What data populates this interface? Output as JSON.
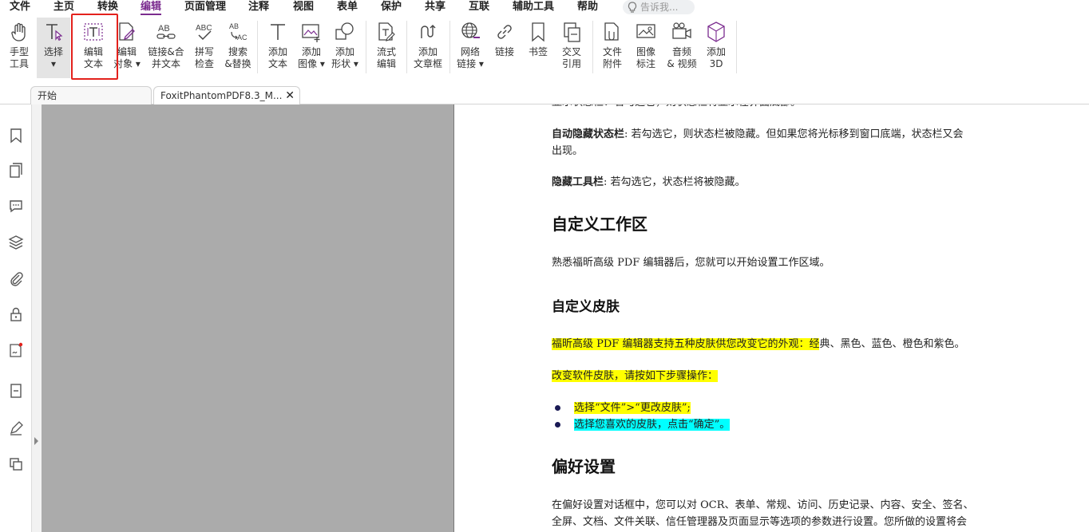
{
  "menu": {
    "items": [
      "文件",
      "主页",
      "转换",
      "编辑",
      "页面管理",
      "注释",
      "视图",
      "表单",
      "保护",
      "共享",
      "互联",
      "辅助工具",
      "帮助"
    ],
    "active": "编辑",
    "tellme_placeholder": "告诉我..."
  },
  "ribbon": {
    "hand": [
      "手型",
      "工具"
    ],
    "select": [
      "选择",
      "▾"
    ],
    "edit_text": [
      "编辑",
      "文本"
    ],
    "edit_object": [
      "编辑",
      "对象 ▾"
    ],
    "link_merge": [
      "链接&合",
      "并文本"
    ],
    "spell": [
      "拼写",
      "检查"
    ],
    "search_replace": [
      "搜索",
      "&替换"
    ],
    "add_text": [
      "添加",
      "文本"
    ],
    "add_image": [
      "添加",
      "图像 ▾"
    ],
    "add_shape": [
      "添加",
      "形状 ▾"
    ],
    "flow_edit": [
      "流式",
      "编辑"
    ],
    "add_textbox": [
      "添加",
      "文章框"
    ],
    "web_link": [
      "网络",
      "链接 ▾"
    ],
    "link": [
      "链接"
    ],
    "bookmark": [
      "书签"
    ],
    "cross_ref": [
      "交叉",
      "引用"
    ],
    "file_attach": [
      "文件",
      "附件"
    ],
    "image_mark": [
      "图像",
      "标注"
    ],
    "audio_video": [
      "音频",
      "& 视频"
    ],
    "add_3d": [
      "添加",
      "3D"
    ]
  },
  "tabs": {
    "start": "开始",
    "doc": "FoxitPhantomPDF8.3_M...",
    "close": "✕"
  },
  "doc": {
    "top_partial": "显示状态栏：若勾选它，则状态栏将显示在界面底部。",
    "auto_hide_b": "自动隐藏状态栏",
    "auto_hide_1": ": 若勾选它，则状态栏被隐藏。但如果您将光标移到窗口底端，状态栏又会",
    "auto_hide_2": "出现。",
    "hide_toolbar_b": "隐藏工具栏",
    "hide_toolbar": ": 若勾选它，状态栏将被隐藏。",
    "h_workspace": "自定义工作区",
    "workspace_p": "熟悉福昕高级 PDF 编辑器后，您就可以开始设置工作区域。",
    "h_skin": "自定义皮肤",
    "skin_p_hl": "福昕高级 PDF 编辑器支持五种皮肤供您改变它的外观：经",
    "skin_p_rest": "典、黑色、蓝色、橙色和紫色。",
    "skin_steps": "改变软件皮肤，请按如下步骤操作：",
    "step1": "选择“文件”>“更改皮肤”;",
    "step2": "选择您喜欢的皮肤，点击“确定”。",
    "h_pref": "偏好设置",
    "pref_1": "在偏好设置对话框中，您可以对 OCR、表单、常规、访问、历史记录、内容、安全、签名、",
    "pref_2": "全屏、文档、文件关联、信任管理器及页面显示等选项的参数进行设置。您所做的设置将会"
  },
  "colors": {
    "accent": "#7b2c8f",
    "highlight_box": "#e3211c",
    "yellow_highlight": "#ffff00",
    "cyan_highlight": "#00ffff"
  }
}
